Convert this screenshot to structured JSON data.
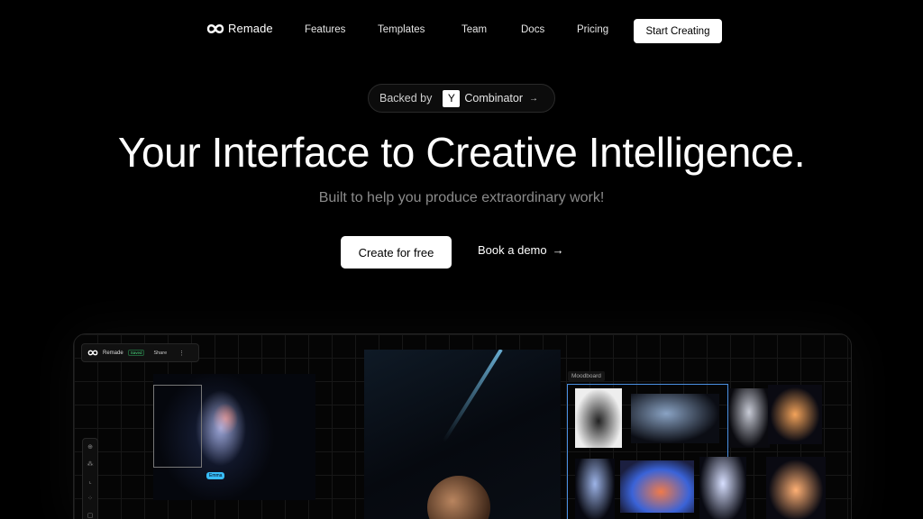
{
  "nav": {
    "logo_text": "Remade",
    "links": [
      "Features",
      "Templates",
      "Team",
      "Docs",
      "Pricing"
    ],
    "cta": "Start Creating"
  },
  "badge": {
    "backed": "Backed by",
    "yc_letter": "Y",
    "yc_name": "Combinator",
    "arrow": "→"
  },
  "hero": {
    "headline": "Your Interface to Creative Intelligence.",
    "subheadline": "Built to help you produce extraordinary work!",
    "primary_button": "Create for free",
    "secondary_button": "Book a demo",
    "secondary_arrow": "→"
  },
  "preview": {
    "toolbar": {
      "name": "Remade",
      "status": "Saved",
      "share": "Share",
      "more": "⋮"
    },
    "tools": [
      "⊕",
      "⁂",
      "⌞",
      "⁘",
      "▢"
    ],
    "chip_label": "Emma",
    "moodboard_label": "Moodboard"
  },
  "colors": {
    "background": "#000000",
    "accent_selection": "#4a90e2",
    "saved_status": "#4ade80",
    "chip": "#38bdf8"
  }
}
